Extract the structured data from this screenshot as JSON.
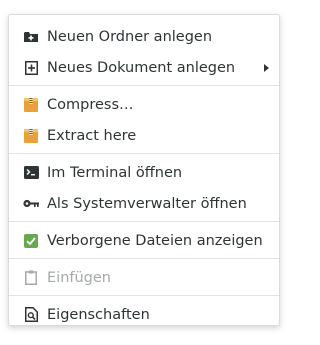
{
  "menu": {
    "items": [
      {
        "label": "Neuen Ordner anlegen",
        "icon": "folder-new-icon"
      },
      {
        "label": "Neues Dokument anlegen",
        "icon": "document-new-icon",
        "submenu": true
      },
      {
        "label": "Compress…",
        "icon": "archive-icon"
      },
      {
        "label": "Extract here",
        "icon": "archive-extract-icon"
      },
      {
        "label": "Im Terminal öffnen",
        "icon": "terminal-icon"
      },
      {
        "label": "Als Systemverwalter öffnen",
        "icon": "key-icon"
      },
      {
        "label": "Verborgene Dateien anzeigen",
        "icon": "checkbox-checked-icon",
        "checked": true
      },
      {
        "label": "Einfügen",
        "icon": "clipboard-icon",
        "disabled": true
      },
      {
        "label": "Eigenschaften",
        "icon": "document-properties-icon"
      }
    ]
  },
  "colors": {
    "text": "#2e3436",
    "disabled_text": "#a5a9ab",
    "archive": "#e9a23b",
    "checkbox": "#6aa84f"
  }
}
